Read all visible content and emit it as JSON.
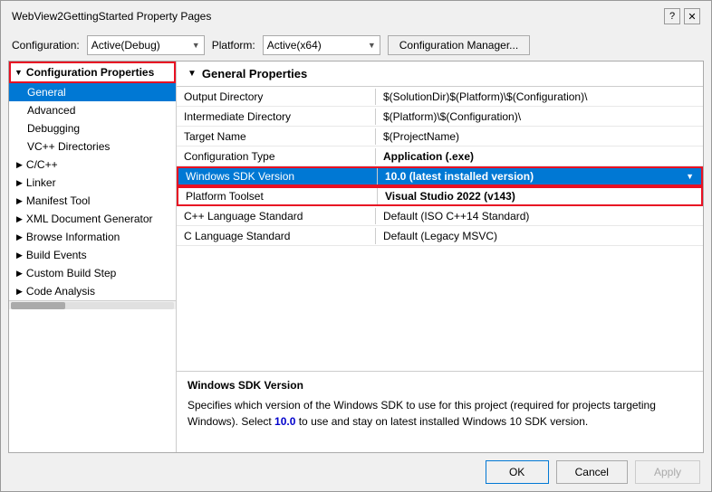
{
  "dialog": {
    "title": "WebView2GettingStarted Property Pages",
    "title_buttons": [
      "?",
      "✕"
    ]
  },
  "config_row": {
    "config_label": "Configuration:",
    "config_value": "Active(Debug)",
    "platform_label": "Platform:",
    "platform_value": "Active(x64)",
    "manager_btn": "Configuration Manager..."
  },
  "sidebar": {
    "section_header": "Configuration Properties",
    "items": [
      {
        "label": "General",
        "indent": 1,
        "selected": true,
        "type": "item"
      },
      {
        "label": "Advanced",
        "indent": 1,
        "type": "item"
      },
      {
        "label": "Debugging",
        "indent": 1,
        "type": "item"
      },
      {
        "label": "VC++ Directories",
        "indent": 1,
        "type": "item"
      },
      {
        "label": "C/C++",
        "indent": 0,
        "type": "expandable"
      },
      {
        "label": "Linker",
        "indent": 0,
        "type": "expandable"
      },
      {
        "label": "Manifest Tool",
        "indent": 0,
        "type": "expandable"
      },
      {
        "label": "XML Document Generator",
        "indent": 0,
        "type": "expandable"
      },
      {
        "label": "Browse Information",
        "indent": 0,
        "type": "expandable"
      },
      {
        "label": "Build Events",
        "indent": 0,
        "type": "expandable"
      },
      {
        "label": "Custom Build Step",
        "indent": 0,
        "type": "expandable"
      },
      {
        "label": "Code Analysis",
        "indent": 0,
        "type": "expandable"
      }
    ]
  },
  "content": {
    "header": "General Properties",
    "properties": [
      {
        "name": "Output Directory",
        "value": "$(SolutionDir)$(Platform)\\$(Configuration)\\",
        "bold": false,
        "selected": false
      },
      {
        "name": "Intermediate Directory",
        "value": "$(Platform)\\$(Configuration)\\",
        "bold": false,
        "selected": false
      },
      {
        "name": "Target Name",
        "value": "$(ProjectName)",
        "bold": false,
        "selected": false
      },
      {
        "name": "Configuration Type",
        "value": "Application (.exe)",
        "bold": true,
        "selected": false
      },
      {
        "name": "Windows SDK Version",
        "value": "10.0 (latest installed version)",
        "bold": true,
        "selected": true,
        "has_arrow": true
      },
      {
        "name": "Platform Toolset",
        "value": "Visual Studio 2022 (v143)",
        "bold": true,
        "selected": false,
        "outline": true
      },
      {
        "name": "C++ Language Standard",
        "value": "Default (ISO C++14 Standard)",
        "bold": false,
        "selected": false
      },
      {
        "name": "C Language Standard",
        "value": "Default (Legacy MSVC)",
        "bold": false,
        "selected": false
      }
    ]
  },
  "description": {
    "title": "Windows SDK Version",
    "text_parts": [
      "Specifies which version of the Windows SDK to use for this project (required for projects targeting Windows). Select ",
      "10.0",
      " to use and stay on latest installed Windows 10 SDK version."
    ]
  },
  "buttons": {
    "ok": "OK",
    "cancel": "Cancel",
    "apply": "Apply"
  }
}
